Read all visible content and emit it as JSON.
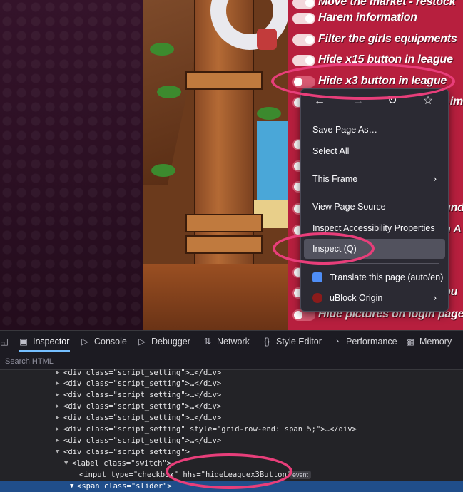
{
  "settings": [
    {
      "label": "Move the market - restock",
      "on": true
    },
    {
      "label": "Harem information",
      "on": true
    },
    {
      "label": "Filter the girls equipments",
      "on": true
    },
    {
      "label": "Hide x15 button in league",
      "on": true
    },
    {
      "label": "Hide x3 button in league",
      "on": false
    },
    {
      "label": "",
      "on": false
    },
    {
      "label": "",
      "on": false
    },
    {
      "label": "",
      "on": false
    },
    {
      "label": "",
      "on": false
    },
    {
      "label": "",
      "on": false
    },
    {
      "label": "",
      "on": false
    },
    {
      "label": "",
      "on": false
    },
    {
      "label": "",
      "on": false
    },
    {
      "label": "",
      "on": false
    },
    {
      "label": "",
      "on": false
    },
    {
      "label": "Hide pictures on login page",
      "on": false
    }
  ],
  "settings_partial_suffixes": {
    "row5": "sim",
    "row10": "und",
    "row11": "n A",
    "row14": "bu"
  },
  "context_menu": {
    "nav": [
      "back-icon",
      "forward-icon",
      "reload-icon",
      "bookmark-star-icon"
    ],
    "save_page_as": "Save Page As…",
    "select_all": "Select All",
    "this_frame": "This Frame",
    "view_page_source": "View Page Source",
    "inspect_accessibility": "Inspect Accessibility Properties",
    "inspect": "Inspect (Q)",
    "translate": "Translate this page (auto/en)",
    "ublock": "uBlock Origin"
  },
  "devtools": {
    "tabs": [
      "Inspector",
      "Console",
      "Debugger",
      "Network",
      "Style Editor",
      "Performance",
      "Memory"
    ],
    "active_tab": "Inspector",
    "search_placeholder": "Search HTML",
    "markup": {
      "l1": "<div class=\"script_setting\">…</div>",
      "l2": "<div class=\"script_setting\">…</div>",
      "l3": "<div class=\"script_setting\">…</div>",
      "l4": "<div class=\"script_setting\">…</div>",
      "l5": "<div class=\"script_setting\">…</div>",
      "l6": "<div class=\"script_setting\" style=\"grid-row-end: span 5;\">…</div>",
      "l7": "<div class=\"script_setting\">…</div>",
      "l8": "<div class=\"script_setting\">",
      "l9": "<label class=\"switch\">",
      "l10_input": "<input type=\"checkbox\" hhs=\"hideLeaguex3Button\">",
      "l10_event": "event",
      "l11": "<span class=\"slider\">"
    }
  },
  "colors": {
    "panel": "#b71f3e",
    "annotation": "#e83e7a",
    "menu_bg": "#2b2a33",
    "devtools_bg": "#232327",
    "selected_row": "#204e8a"
  }
}
